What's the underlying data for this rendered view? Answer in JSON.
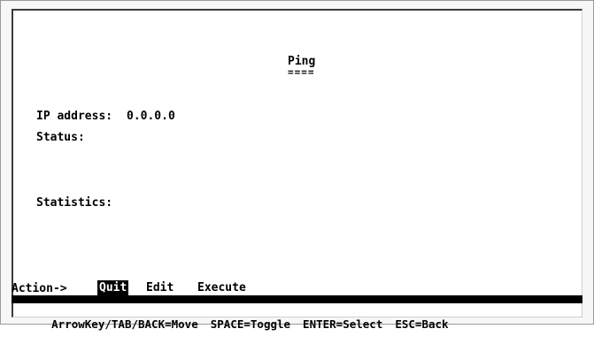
{
  "screen": {
    "title": "Ping",
    "title_underline": "===="
  },
  "fields": {
    "ip_label": "IP address:",
    "ip_value": "0.0.0.0",
    "status_label": "Status:",
    "statistics_label": "Statistics:"
  },
  "action_bar": {
    "prompt": "Action->",
    "items": [
      {
        "label": "Quit",
        "selected": true
      },
      {
        "label": "Edit",
        "selected": false
      },
      {
        "label": "Execute",
        "selected": false
      }
    ]
  },
  "help": [
    "ArrowKey/TAB/BACK=Move",
    "SPACE=Toggle",
    "ENTER=Select",
    "ESC=Back"
  ],
  "colors": {
    "background": "#ffffff",
    "text": "#000000",
    "highlight_bg": "#000000",
    "highlight_fg": "#ffffff"
  }
}
